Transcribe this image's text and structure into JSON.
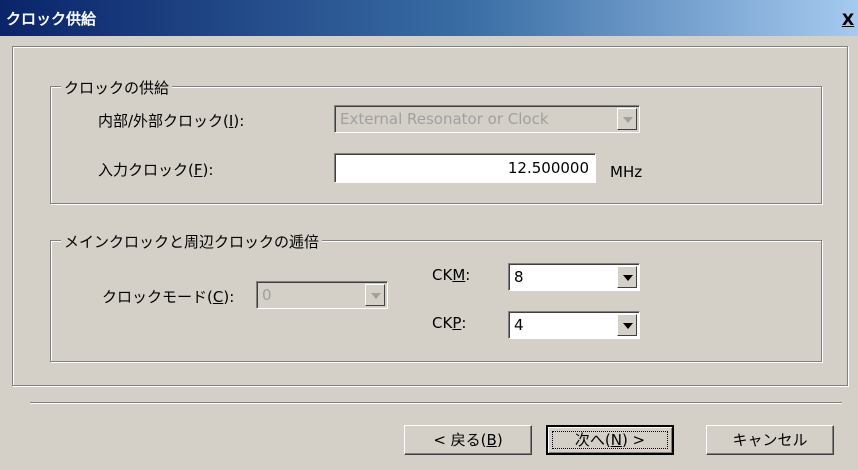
{
  "dialog": {
    "title": "クロック供給",
    "close_label": "X"
  },
  "supply_group": {
    "legend": "クロックの供給",
    "internal_external": {
      "label_prefix": "内部/外部クロック(",
      "label_key": "I",
      "label_suffix": "):",
      "value": "External Resonator or Clock"
    },
    "input_clock": {
      "label_prefix": "入力クロック(",
      "label_key": "F",
      "label_suffix": "):",
      "value": "12.500000",
      "unit": "MHz"
    }
  },
  "multiplier_group": {
    "legend": "メインクロックと周辺クロックの逓倍",
    "clock_mode": {
      "label_prefix": "クロックモード(",
      "label_key": "C",
      "label_suffix": "):",
      "value": "0"
    },
    "ckm": {
      "label_prefix": "CK",
      "label_key": "M",
      "label_suffix": ":",
      "value": "8"
    },
    "ckp": {
      "label_prefix": "CK",
      "label_key": "P",
      "label_suffix": ":",
      "value": "4"
    }
  },
  "buttons": {
    "back": {
      "prefix": "< 戻る(",
      "key": "B",
      "suffix": ")"
    },
    "next": {
      "prefix": "次へ(",
      "key": "N",
      "suffix": ") >"
    },
    "cancel": {
      "label": "キャンセル"
    }
  }
}
